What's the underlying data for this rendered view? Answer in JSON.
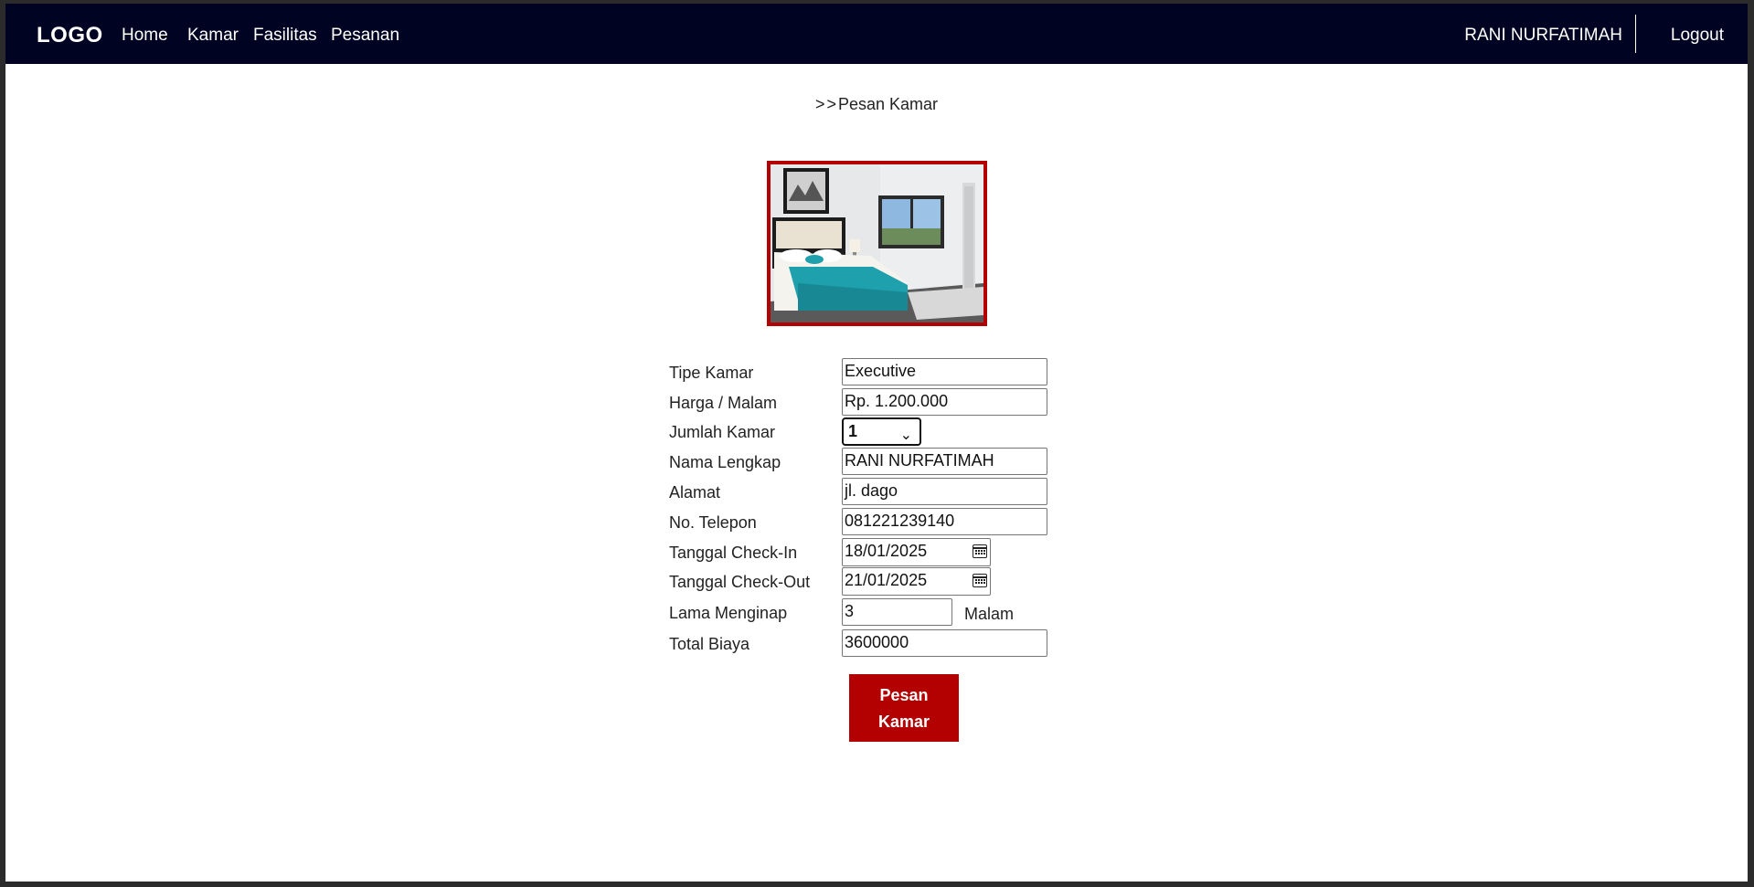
{
  "navbar": {
    "logo": "LOGO",
    "links": [
      "Home",
      "Kamar",
      "Fasilitas",
      "Pesanan"
    ],
    "user_name": "RANI NURFATIMAH",
    "logout": "Logout"
  },
  "breadcrumb": {
    "arrows": ">>",
    "title": "Pesan Kamar"
  },
  "colors": {
    "navbar_bg": "#000322",
    "accent": "#b30000",
    "page_bg": "#ffffff"
  },
  "form": {
    "tipe_kamar": {
      "label": "Tipe Kamar",
      "value": "Executive"
    },
    "harga": {
      "label": "Harga / Malam",
      "value": "Rp. 1.200.000"
    },
    "jumlah_kamar": {
      "label": "Jumlah Kamar",
      "value": "1"
    },
    "nama": {
      "label": "Nama Lengkap",
      "value": "RANI NURFATIMAH"
    },
    "alamat": {
      "label": "Alamat",
      "value": "jl. dago"
    },
    "telepon": {
      "label": "No. Telepon",
      "value": "081221239140"
    },
    "checkin": {
      "label": "Tanggal Check-In",
      "value": "18/01/2025"
    },
    "checkout": {
      "label": "Tanggal Check-Out",
      "value": "21/01/2025"
    },
    "lama": {
      "label": "Lama Menginap",
      "value": "3",
      "unit": "Malam"
    },
    "total": {
      "label": "Total Biaya",
      "value": "3600000"
    },
    "submit_label": "Pesan Kamar"
  }
}
